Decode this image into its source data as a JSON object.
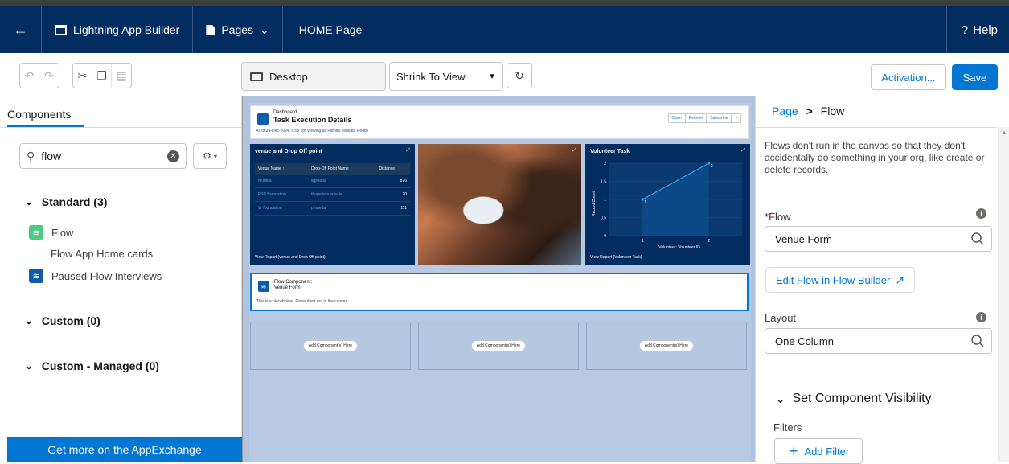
{
  "topbar": {
    "app_title": "Lightning App Builder",
    "pages_label": "Pages",
    "page_name": "HOME Page",
    "help_label": "Help"
  },
  "toolbar": {
    "device": "Desktop",
    "view_mode": "Shrink To View",
    "activation_label": "Activation...",
    "save_label": "Save"
  },
  "left_panel": {
    "tab_label": "Components",
    "search_value": "flow",
    "sections": [
      {
        "label": "Standard (3)"
      },
      {
        "label": "Custom (0)"
      },
      {
        "label": "Custom - Managed (0)"
      }
    ],
    "items": [
      {
        "label": "Flow"
      },
      {
        "label": "Flow App Home cards"
      },
      {
        "label": "Paused Flow Interviews"
      }
    ],
    "appexchange_label": "Get more on the AppExchange"
  },
  "canvas": {
    "dashboard": {
      "small_label": "Dashboard",
      "title": "Task Execution Details",
      "subtitle": "As of 29-Dec-2024, 6:08 pm Viewing as Pammi Venkata Reddy",
      "buttons": [
        "Open",
        "Refresh",
        "Subscribe",
        "▾"
      ]
    },
    "widget1": {
      "title": "venue and Drop Off point",
      "columns": [
        "Venue Name ↑",
        "Drop-Off Point Name",
        "Distance"
      ],
      "rows": [
        [
          "mumba",
          "wpinada",
          "876"
        ],
        [
          "FSR foundation",
          "thogeriepuvdaala",
          "20"
        ],
        [
          "Vr foundation",
          "pnmeda",
          "111"
        ]
      ],
      "footer": "View Report (venue and Drop Off point)"
    },
    "widget3": {
      "title": "Volunteer Task",
      "chart_data": {
        "type": "line",
        "x": [
          1,
          2
        ],
        "values": [
          1,
          2
        ],
        "xlabel": "Volunteer: Volunteer ID",
        "ylabel": "Record Count",
        "yticks": [
          "2",
          "1.5",
          "1",
          "0.5",
          "0"
        ],
        "xticks": [
          "1",
          "2"
        ],
        "ylim": [
          0,
          2
        ]
      },
      "footer": "View Report (Volunteer Task)"
    },
    "flow_component": {
      "line1": "Flow Component:",
      "line2": "Venue Form",
      "note": "This is a placeholder. Flows don't run in the canvas."
    },
    "add_component_label": "Add Component(s) Here"
  },
  "right_panel": {
    "breadcrumb_page": "Page",
    "breadcrumb_sep": ">",
    "breadcrumb_current": "Flow",
    "info_text": "Flows don't run in the canvas so that they don't accidentally do something in your org, like create or delete records.",
    "flow_label": "Flow",
    "flow_value": "Venue Form",
    "edit_flow_label": "Edit Flow in Flow Builder",
    "layout_label": "Layout",
    "layout_value": "One Column",
    "visibility_label": "Set Component Visibility",
    "filters_label": "Filters",
    "add_filter_label": "Add Filter"
  },
  "colors": {
    "header_bg": "#032d60",
    "brand_blue": "#0176d3",
    "canvas_bg": "#b0c4df"
  }
}
